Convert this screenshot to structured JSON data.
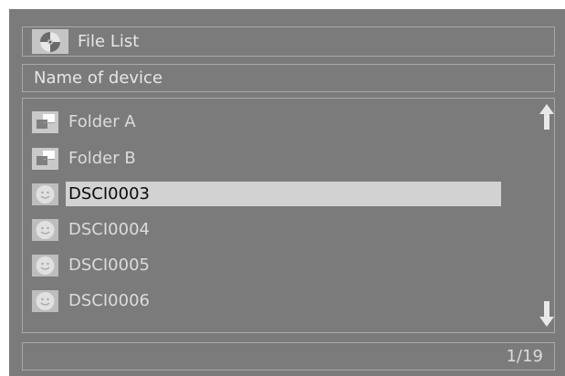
{
  "title_bar": {
    "title": "File List",
    "icon": "disc-icon"
  },
  "device_bar": {
    "label": "Name of device"
  },
  "file_list": {
    "items": [
      {
        "label": "Folder A",
        "icon": "folder-icon",
        "selected": false
      },
      {
        "label": "Folder B",
        "icon": "folder-icon",
        "selected": false
      },
      {
        "label": "DSCI0003",
        "icon": "photo-icon",
        "selected": true
      },
      {
        "label": "DSCI0004",
        "icon": "photo-icon",
        "selected": false
      },
      {
        "label": "DSCI0005",
        "icon": "photo-icon",
        "selected": false
      },
      {
        "label": "DSCI0006",
        "icon": "photo-icon",
        "selected": false
      }
    ],
    "scroll_up_icon": "arrow-up-icon",
    "scroll_down_icon": "arrow-down-icon"
  },
  "status_bar": {
    "page": "1/19"
  },
  "colors": {
    "background": "#7b7b7b",
    "border": "#a9a9a9",
    "text": "#dcdcdc",
    "selection": "#d2d2d2",
    "selected_text": "#0a0a0a"
  }
}
